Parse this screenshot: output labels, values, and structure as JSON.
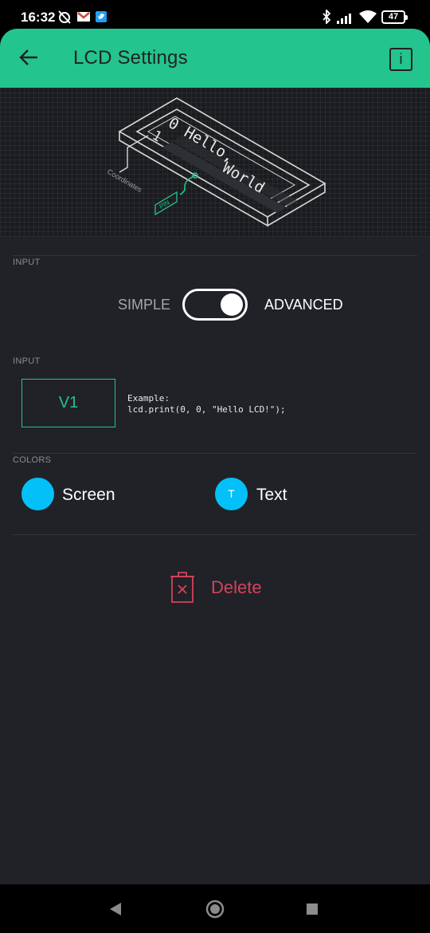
{
  "status_bar": {
    "time": "16:32",
    "battery": "47",
    "icons": [
      "alarm-off-icon",
      "gmail-icon",
      "twitter-icon",
      "bluetooth-icon",
      "signal-icon",
      "wifi-icon",
      "battery-icon"
    ]
  },
  "header": {
    "title": "LCD Settings",
    "back_icon": "arrow-left-icon",
    "info_label": "i"
  },
  "illustration": {
    "row0": "0 Hello,",
    "row1": "World",
    "row_number": "1",
    "coordinates_label": "Coordinates",
    "pin_label": "PIN"
  },
  "input_mode": {
    "section_label": "INPUT",
    "simple_label": "SIMPLE",
    "advanced_label": "ADVANCED",
    "toggle_on": true
  },
  "pin_input": {
    "section_label": "INPUT",
    "pin_value": "V1",
    "example_line1": "Example:",
    "example_line2": "lcd.print(0, 0, \"Hello LCD!\");"
  },
  "colors": {
    "section_label": "COLORS",
    "screen_label": "Screen",
    "text_label": "Text",
    "text_letter": "T",
    "screen_color": "#04c0f8",
    "text_color": "#04c0f8"
  },
  "actions": {
    "delete_label": "Delete",
    "delete_color": "#d3435c"
  },
  "theme": {
    "accent": "#23c48e",
    "background": "#212227"
  },
  "nav": {
    "icons": [
      "back-triangle-icon",
      "home-circle-icon",
      "recents-square-icon"
    ]
  }
}
